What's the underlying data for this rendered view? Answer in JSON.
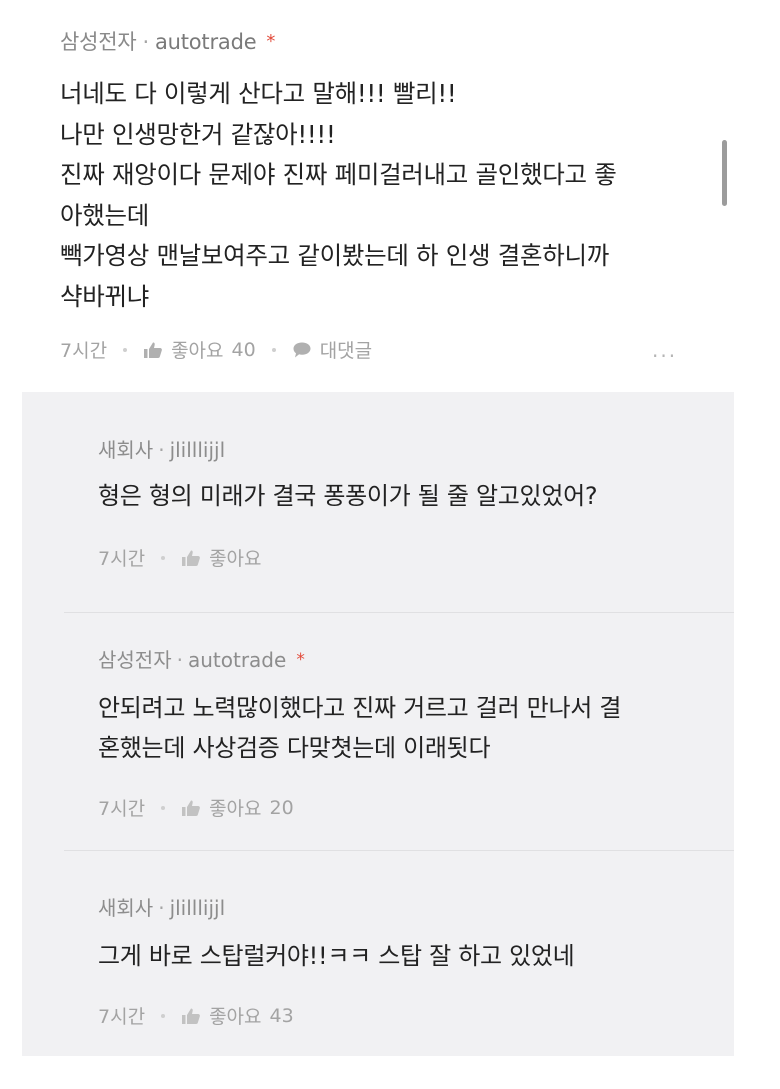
{
  "post": {
    "company": "삼성전자",
    "username": "autotrade",
    "author_star": "*",
    "body": "너네도 다 이렇게 산다고 말해!!! 빨리!!\n나만 인생망한거 같잖아!!!!\n진짜 재앙이다 문제야 진짜 페미걸러내고 골인했다고 좋\n아했는데\n빽가영상 맨날보여주고 같이봤는데 하 인생 결혼하니까\n샥바뀌냐",
    "time": "7시간",
    "like_label": "좋아요",
    "like_count": "40",
    "reply_label": "대댓글",
    "more_label": "···"
  },
  "replies": [
    {
      "company": "새회사",
      "username": "jlilllijjl",
      "author_star": "",
      "body": "형은 형의 미래가 결국 퐁퐁이가 될 줄 알고있었어?",
      "time": "7시간",
      "like_label": "좋아요",
      "like_count": ""
    },
    {
      "company": "삼성전자",
      "username": "autotrade",
      "author_star": "*",
      "body": "안되려고 노력많이했다고 진짜 거르고 걸러 만나서 결\n혼했는데 사상검증 다맞쳣는데 이래됫다",
      "time": "7시간",
      "like_label": "좋아요",
      "like_count": "20"
    },
    {
      "company": "새회사",
      "username": "jlilllijjl",
      "author_star": "",
      "body": "그게 바로 스탑럴커야!!ㅋㅋ 스탑 잘 하고 있었네",
      "time": "7시간",
      "like_label": "좋아요",
      "like_count": "43"
    }
  ],
  "colors": {
    "background": "#ffffff",
    "reply_background": "#f1f1f3",
    "author_star": "#e24b3b",
    "meta_text": "#8a8a8a"
  }
}
